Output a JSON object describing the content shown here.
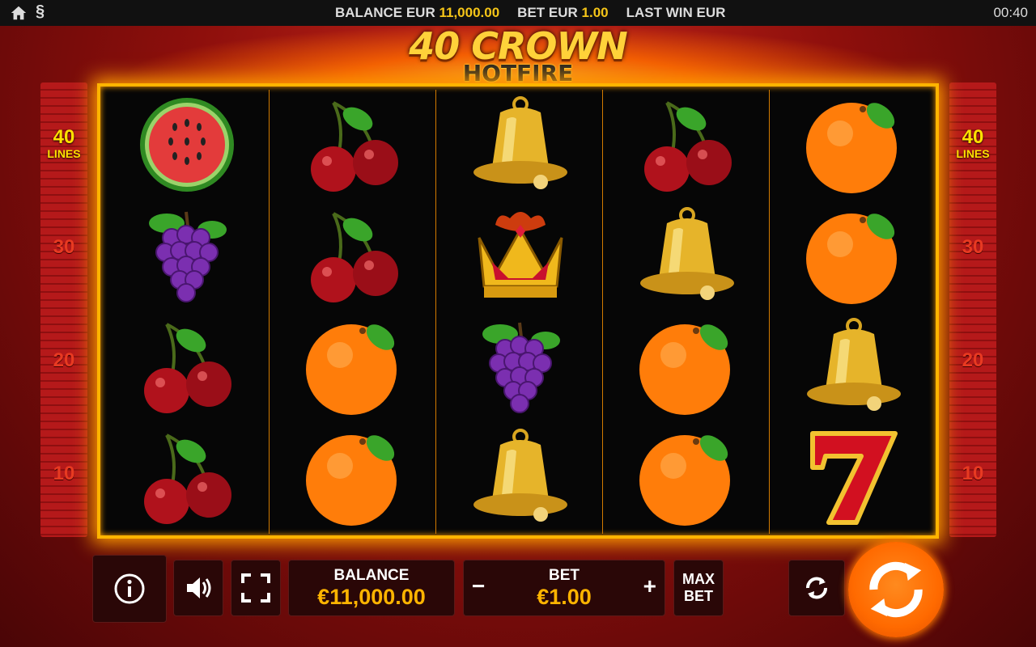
{
  "topbar": {
    "home_icon": "home-icon",
    "paragraph_icon": "§",
    "balance_label": "BALANCE EUR",
    "balance_value": "11,000.00",
    "bet_label": "BET EUR",
    "bet_value": "1.00",
    "last_win_label": "LAST WIN EUR",
    "clock": "00:40"
  },
  "logo": {
    "line1": "40 CROWN",
    "line2": "HOTFIRE"
  },
  "meter": {
    "lines_number": "40",
    "lines_label": "LINES",
    "markers": [
      "30",
      "20",
      "10"
    ]
  },
  "reels": [
    [
      "watermelon",
      "grapes",
      "cherry",
      "cherry"
    ],
    [
      "cherry",
      "cherry",
      "orange",
      "orange"
    ],
    [
      "bell",
      "crown",
      "grapes",
      "bell"
    ],
    [
      "cherry",
      "bell",
      "orange",
      "orange"
    ],
    [
      "orange",
      "orange",
      "bell",
      "seven"
    ]
  ],
  "controls": {
    "info_icon": "info-icon",
    "sound_icon": "sound-icon",
    "fullscreen_icon": "fullscreen-icon",
    "balance_label": "BALANCE",
    "balance_value": "€11,000.00",
    "bet_label": "BET",
    "bet_value": "€1.00",
    "bet_minus": "−",
    "bet_plus": "+",
    "maxbet_line1": "MAX",
    "maxbet_line2": "BET",
    "autoplay_icon": "autoplay-icon",
    "spin_icon": "spin-icon"
  },
  "colors": {
    "frame": "#ffb400",
    "accent_yellow": "#ffe100",
    "value_orange": "#ffb400",
    "spin_orange": "#ff6a00"
  }
}
